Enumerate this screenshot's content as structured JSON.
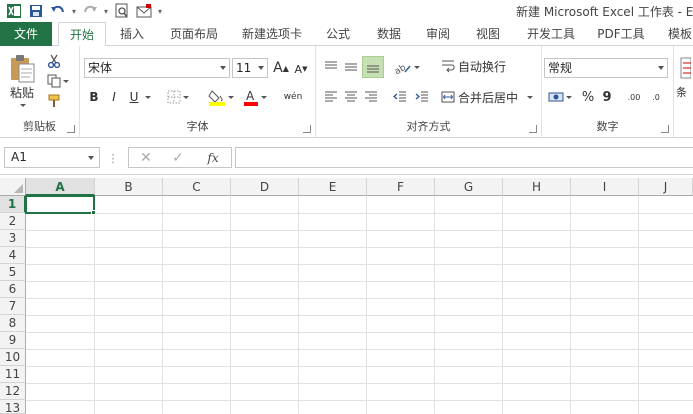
{
  "window": {
    "title": "新建 Microsoft Excel 工作表 - Exc"
  },
  "ribbon_tabs": [
    {
      "label": "文件"
    },
    {
      "label": "开始"
    },
    {
      "label": "插入"
    },
    {
      "label": "页面布局"
    },
    {
      "label": "新建选项卡"
    },
    {
      "label": "公式"
    },
    {
      "label": "数据"
    },
    {
      "label": "审阅"
    },
    {
      "label": "视图"
    },
    {
      "label": "开发工具"
    },
    {
      "label": "PDF工具"
    },
    {
      "label": "模板"
    }
  ],
  "clipboard": {
    "label": "剪贴板",
    "paste_label": "粘贴"
  },
  "font": {
    "label": "字体",
    "font_name": "宋体",
    "font_size": "11",
    "bold": "B",
    "italic": "I",
    "underline": "U",
    "grow": "A",
    "shrink": "A",
    "phonetic": "wén"
  },
  "alignment": {
    "label": "对齐方式",
    "wrap_text": "自动换行",
    "merge_center": "合并后居中"
  },
  "number": {
    "label": "数字",
    "format": "常规",
    "percent": "%",
    "comma": "9",
    "inc_decimal": ".00",
    "dec_decimal": ".0"
  },
  "styles": {
    "partial_label": "条"
  },
  "formula_bar": {
    "name_box": "A1",
    "fx": "fx",
    "value": ""
  },
  "columns": [
    "A",
    "B",
    "C",
    "D",
    "E",
    "F",
    "G",
    "H",
    "I",
    "J"
  ],
  "rows": [
    "1",
    "2",
    "3",
    "4",
    "5",
    "6",
    "7",
    "8",
    "9",
    "10",
    "11",
    "12",
    "13"
  ],
  "colors": {
    "accent": "#217346",
    "highlight_yellow": "#ffff00",
    "font_red": "#ff0000"
  }
}
